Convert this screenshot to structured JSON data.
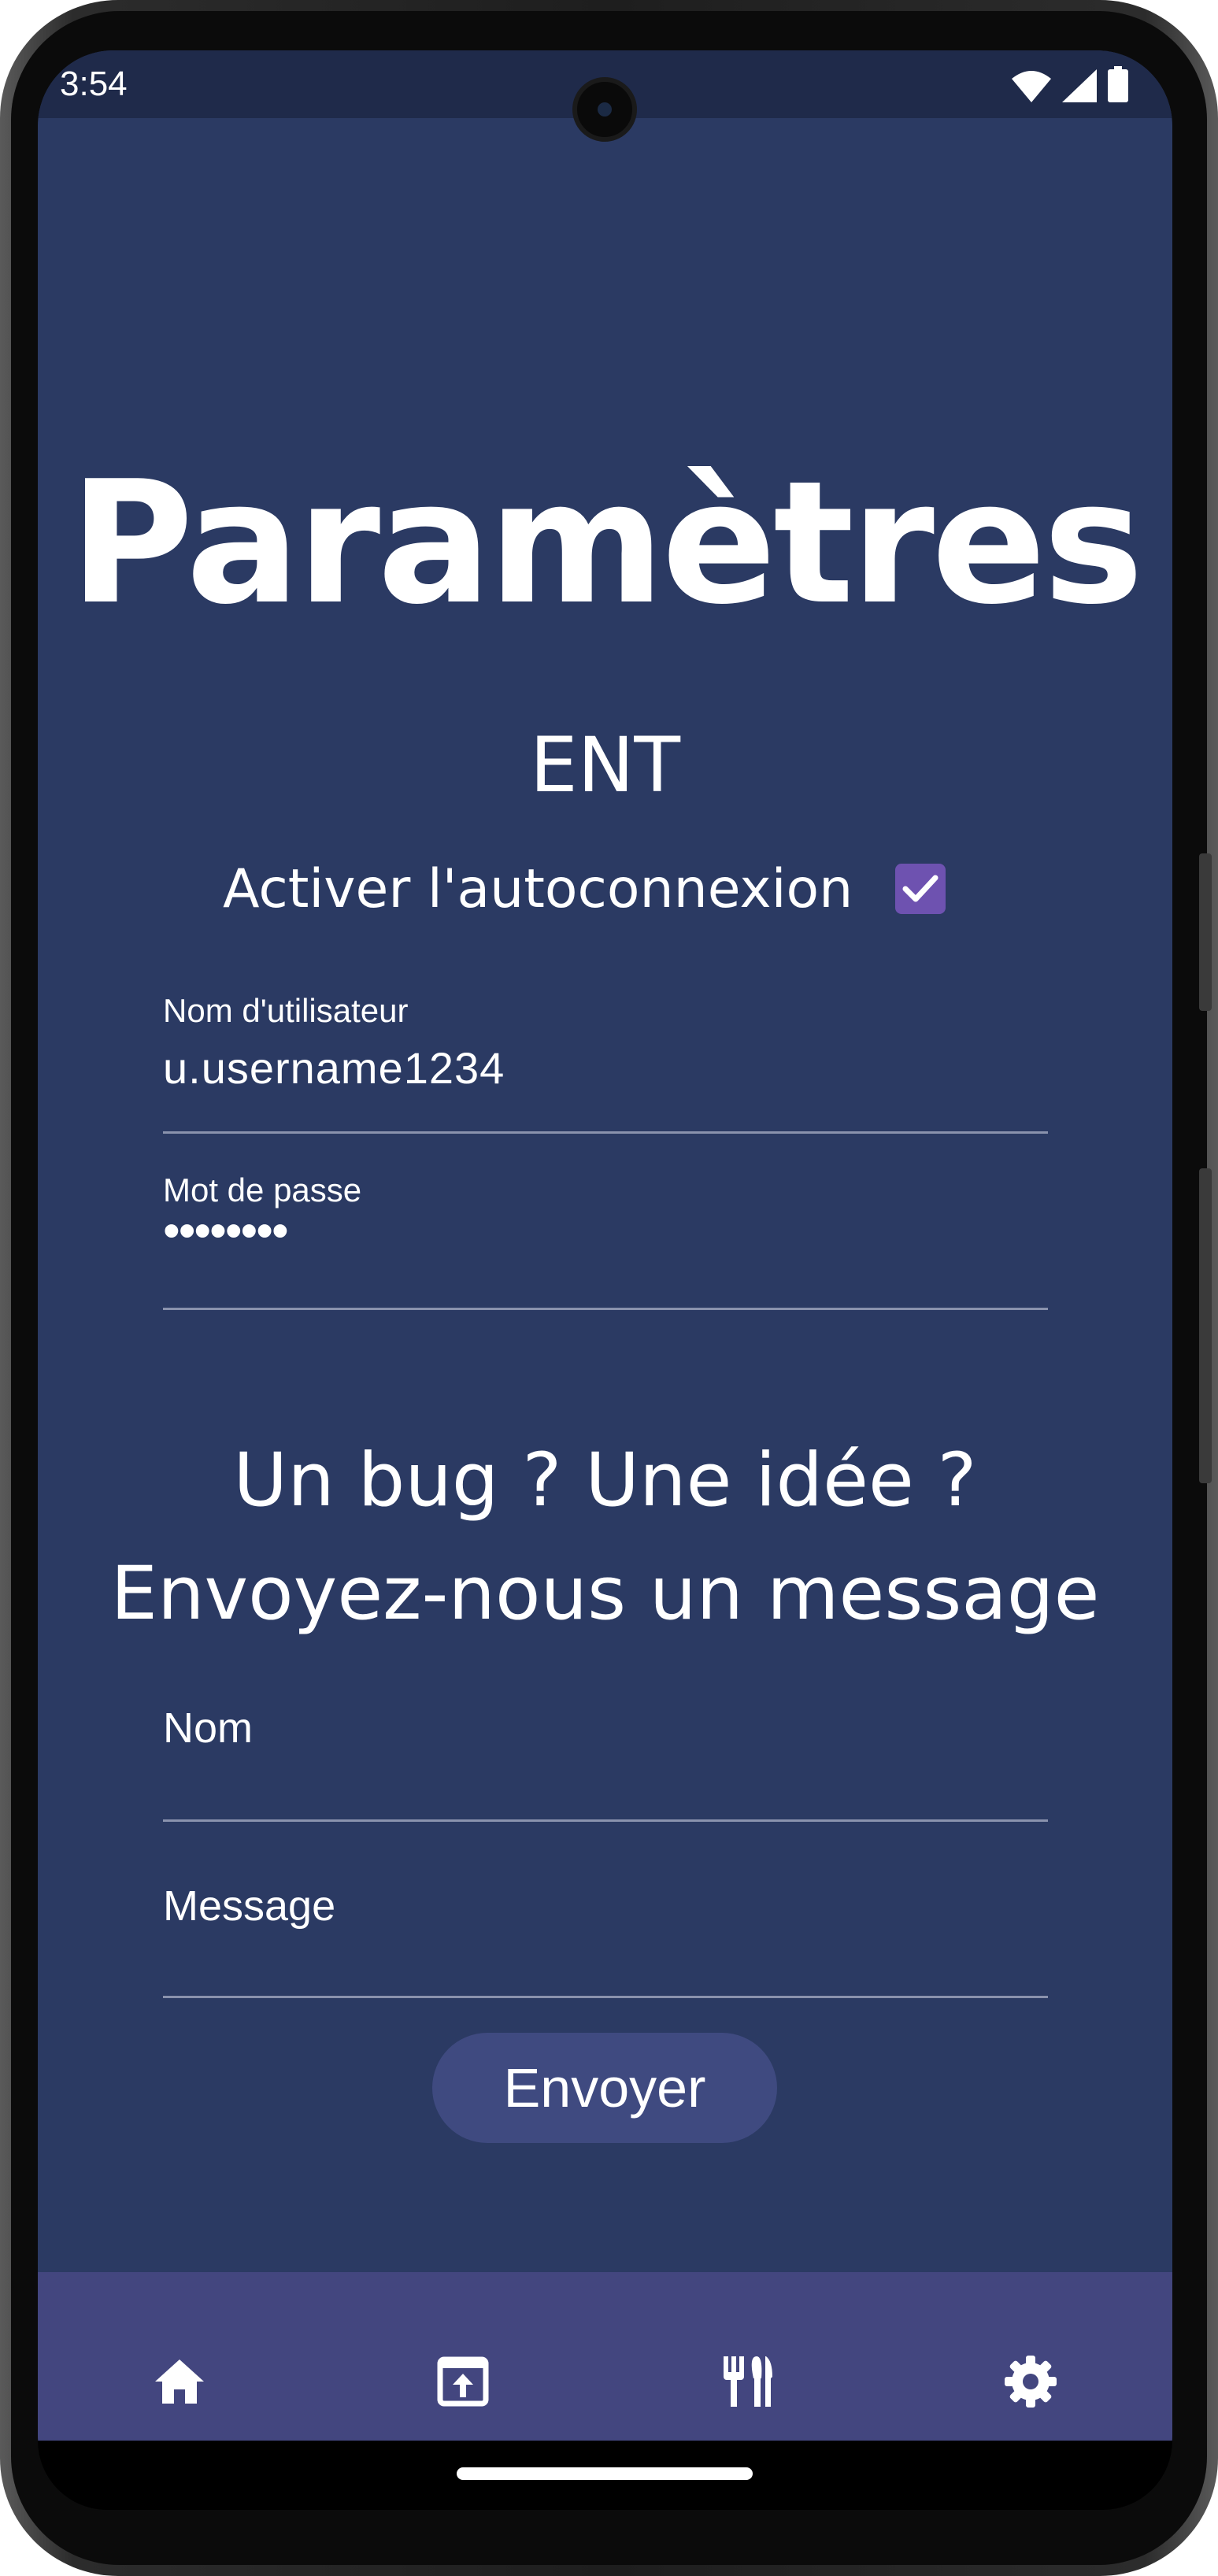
{
  "status_bar": {
    "time": "3:54"
  },
  "settings": {
    "title": "Paramètres",
    "ent_section": "ENT",
    "autoconnect_label": "Activer l'autoconnexion",
    "autoconnect_checked": true,
    "username_label": "Nom d'utilisateur",
    "username_value": "u.username1234",
    "password_label": "Mot de passe",
    "password_value": "••••••••"
  },
  "feedback": {
    "title_line1": "Un bug ? Une idée ?",
    "title_line2": "Envoyez-nous un message",
    "name_label": "Nom",
    "message_label": "Message",
    "send_label": "Envoyer"
  },
  "bottom_nav": {
    "items": [
      {
        "icon": "home-icon"
      },
      {
        "icon": "open-in-app-icon"
      },
      {
        "icon": "restaurant-icon"
      },
      {
        "icon": "settings-gear-icon"
      }
    ]
  },
  "colors": {
    "background": "#2b3a63",
    "status_bar": "#1f2a4a",
    "bottom_nav": "#43467f",
    "checkbox": "#6e52b0",
    "button": "#3f4a80",
    "text": "#ffffff"
  }
}
